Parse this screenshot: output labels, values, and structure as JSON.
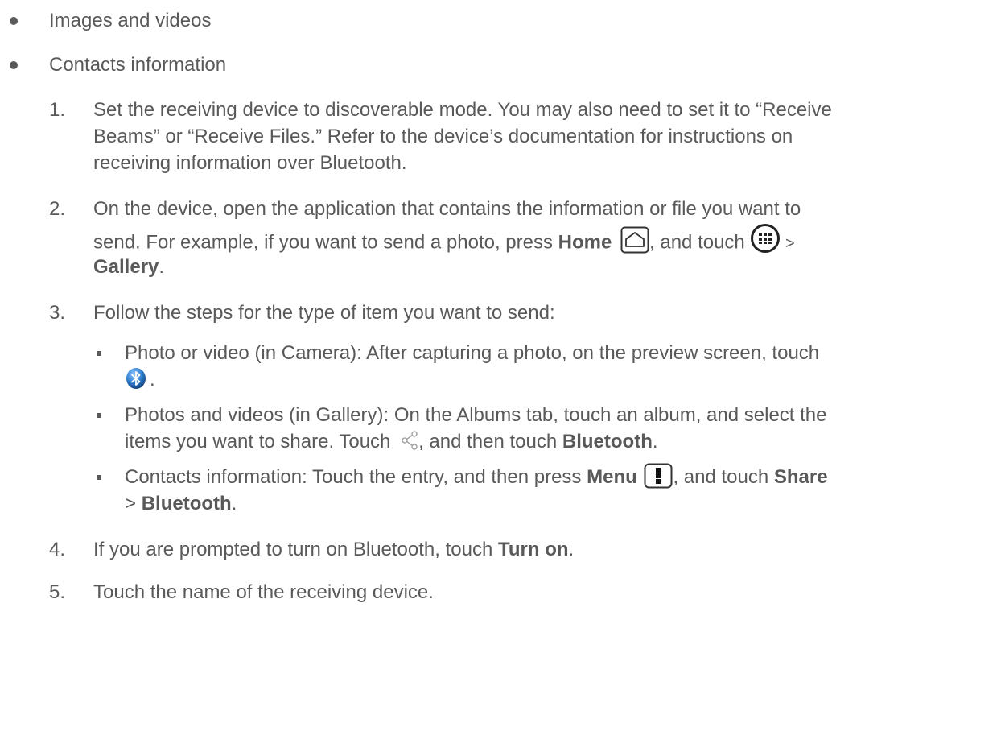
{
  "bullets": [
    "Images and videos",
    "Contacts information"
  ],
  "steps": {
    "s1": {
      "num": "1.",
      "l1": "Set the receiving device to discoverable mode. You may also need to set it to “Receive",
      "l2": "Beams” or “Receive Files.” Refer to the device’s documentation for instructions on",
      "l3": "receiving information over Bluetooth."
    },
    "s2": {
      "num": "2.",
      "l1": "On the device, open the application that contains the information or file you want to",
      "l2a": "send. For example, if you want to send a photo, press ",
      "home": "Home",
      "l2b": ", and touch ",
      "l2c": " >",
      "gallery": "Gallery",
      "l3end": "."
    },
    "s3": {
      "num": "3.",
      "l1": "Follow the steps for the type of item you want to send:"
    },
    "s3_sub": {
      "a1": "Photo or video (in Camera): After capturing a photo, on the preview screen, touch",
      "a2end": ".",
      "b1": "Photos and videos (in Gallery): On the Albums tab, touch an album, and select the",
      "b2a": "items you want to share. Touch ",
      "b2b": ", and then touch ",
      "bluetooth": "Bluetooth",
      "b2end": ".",
      "c1a": "Contacts information: Touch the entry, and then press ",
      "menu": "Menu",
      "c1b": ", and touch ",
      "share": "Share",
      "c2a": "> ",
      "c2end": "."
    },
    "s4": {
      "num": "4.",
      "l1a": "If you are prompted to turn on Bluetooth, touch ",
      "turn_on": "Turn on",
      "l1end": "."
    },
    "s5": {
      "num": "5.",
      "l1": "Touch the name of the receiving device."
    }
  },
  "icons": {
    "home": "home-icon",
    "apps": "apps-grid-icon",
    "bluetooth": "bluetooth-icon",
    "share": "share-icon",
    "menu": "menu-icon"
  },
  "colors": {
    "text": "#595959",
    "bluetooth_blue": "#2f7fd0"
  }
}
